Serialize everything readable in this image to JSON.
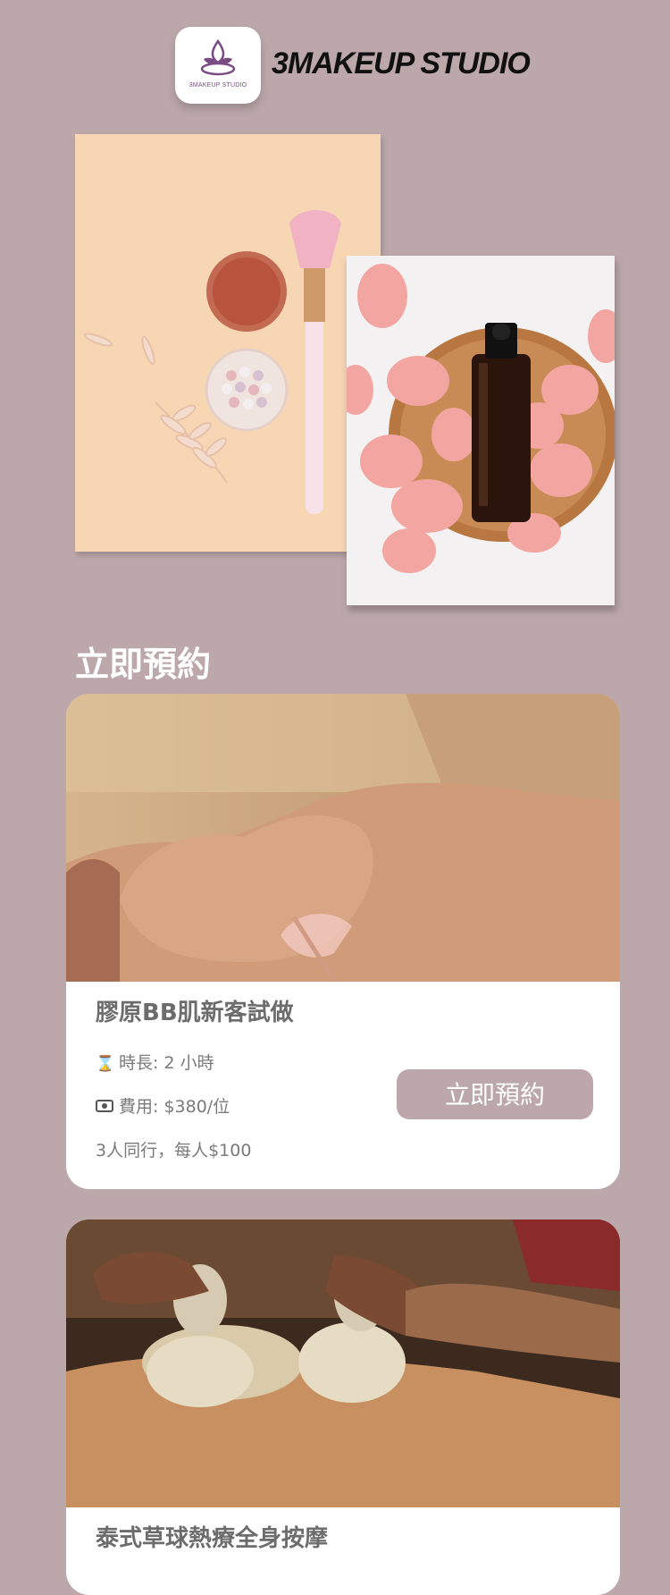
{
  "brand": {
    "logo_text": "3MAKEUP STUDIO",
    "title": "3MAKEUP STUDIO"
  },
  "section": {
    "title": "立即預約"
  },
  "cards": [
    {
      "title": "膠原BB肌新客試做",
      "duration_icon": "hourglass-icon",
      "duration": "時長: 2 小時",
      "price_icon": "money-icon",
      "price": "費用: $380/位",
      "promo": "3人同行，每人$100",
      "button": "立即預約"
    },
    {
      "title": "泰式草球熱療全身按摩"
    }
  ],
  "colors": {
    "background": "#bca8aa",
    "accent": "#bca8aa",
    "card": "#ffffff",
    "brand_purple": "#7a4c86"
  }
}
